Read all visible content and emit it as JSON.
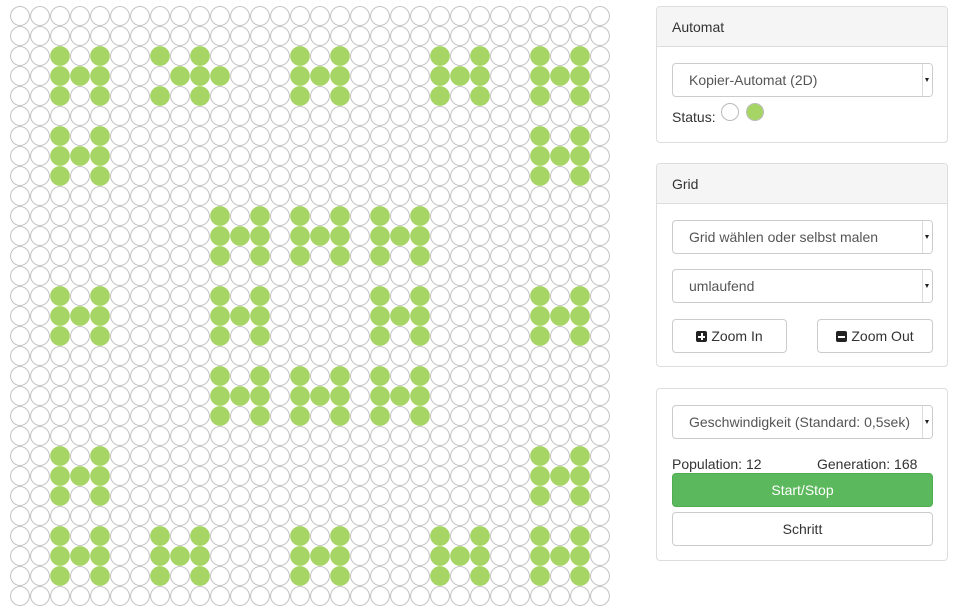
{
  "colors": {
    "alive": "#a6d565",
    "dead": "#ffffff",
    "cell_border": "#bbbbbb",
    "success": "#5cb85c"
  },
  "grid": {
    "rows": 30,
    "cols": 30,
    "alive_pattern": [
      ".............................",
      "..............................",
      "..#.#..#.#....#.#....#.#..#.#.",
      "..###...###...###....###..###.",
      "..#.#..#.#....#.#....#.#..#.#.",
      "..............................",
      "..#.#.....................#.#.",
      "..###.....................###.",
      "..#.#.....................#.#.",
      "..............................",
      "..........#.#.#.#.#.#.........",
      "..........###.###.###.........",
      "..........#.#.#.#.#.#.........",
      "..............................",
      "..#.#.....#.#.....#.#.....#.#.",
      "..###.....###.....###.....###.",
      "..#.#.....#.#.....#.#.....#.#.",
      "..............................",
      "..........#.#.#.#.#.#.........",
      "..........###.###.###.........",
      "..........#.#.#.#.#.#.........",
      "..............................",
      "..#.#.....................#.#.",
      "..###.....................###.",
      "..#.#.....................#.#.",
      "..............................",
      "..#.#..#.#....#.#....#.#..#.#.",
      "..###..###....###....###..###.",
      "..#.#..#.#....#.#....#.#..#.#.",
      ".............................."
    ]
  },
  "automat_panel": {
    "title": "Automat",
    "select_value": "Kopier-Automat (2D)",
    "status_label": "Status:"
  },
  "grid_panel": {
    "title": "Grid",
    "grid_select": "Grid wählen oder selbst malen",
    "boundary_select": "umlaufend",
    "zoom_in": "Zoom In",
    "zoom_out": "Zoom Out"
  },
  "control_panel": {
    "speed_select": "Geschwindigkeit (Standard: 0,5sek)",
    "population_label": "Population: 12",
    "generation_label": "Generation: 168",
    "start_stop": "Start/Stop",
    "step": "Schritt"
  }
}
